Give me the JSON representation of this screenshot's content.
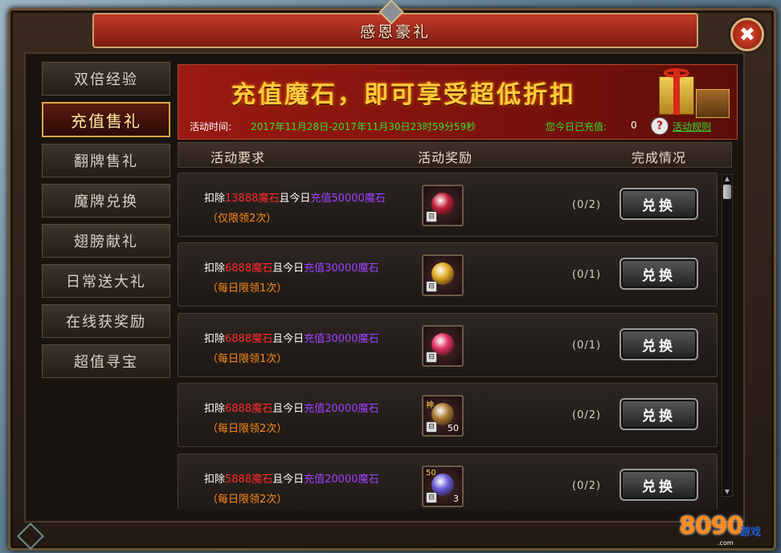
{
  "window": {
    "title": "感恩豪礼",
    "close_label": "✖"
  },
  "sidebar": {
    "items": [
      {
        "label": "双倍经验",
        "active": false
      },
      {
        "label": "充值售礼",
        "active": true
      },
      {
        "label": "翻牌售礼",
        "active": false
      },
      {
        "label": "魔牌兑换",
        "active": false
      },
      {
        "label": "翅膀献礼",
        "active": false
      },
      {
        "label": "日常送大礼",
        "active": false
      },
      {
        "label": "在线获奖励",
        "active": false
      },
      {
        "label": "超值寻宝",
        "active": false
      }
    ]
  },
  "banner": {
    "slogan": "充值魔石，即可享受超低折扣",
    "time_label": "活动时间:",
    "time_value": "2017年11月28日-2017年11月30日23时59分59秒",
    "charged_label": "您今日已充值:",
    "charged_value": "0",
    "help_label": "?",
    "rules_link": "活动规则"
  },
  "table": {
    "headers": {
      "requirement": "活动要求",
      "reward": "活动奖励",
      "status": "完成情况"
    },
    "rows": [
      {
        "prefix": "扣除",
        "cost": "13888魔石",
        "mid": "且今日",
        "charge": "充值50000魔石",
        "limit": "（仅限领2次）",
        "progress": "(0/2)",
        "button": "兑换",
        "reward_icon": "red-orb-icon",
        "reward_color": "#c0203a",
        "reward_count": "",
        "reward_tag": ""
      },
      {
        "prefix": "扣除",
        "cost": "6888魔石",
        "mid": "且今日",
        "charge": "充值30000魔石",
        "limit": "（每日限领1次）",
        "progress": "(0/1)",
        "button": "兑换",
        "reward_icon": "gold-crystal-icon",
        "reward_color": "#e0a820",
        "reward_count": "",
        "reward_tag": ""
      },
      {
        "prefix": "扣除",
        "cost": "6888魔石",
        "mid": "且今日",
        "charge": "充值30000魔石",
        "limit": "（每日限领1次）",
        "progress": "(0/1)",
        "button": "兑换",
        "reward_icon": "red-crystal-icon",
        "reward_color": "#e03060",
        "reward_count": "",
        "reward_tag": ""
      },
      {
        "prefix": "扣除",
        "cost": "6888魔石",
        "mid": "且今日",
        "charge": "充值20000魔石",
        "limit": "（每日限领2次）",
        "progress": "(0/2)",
        "button": "兑换",
        "reward_icon": "divine-scroll-icon",
        "reward_color": "#a87a30",
        "reward_count": "50",
        "reward_tag": "神"
      },
      {
        "prefix": "扣除",
        "cost": "5888魔石",
        "mid": "且今日",
        "charge": "充值20000魔石",
        "limit": "（每日限领2次）",
        "progress": "(0/2)",
        "button": "兑换",
        "reward_icon": "soul-orb-icon",
        "reward_color": "#6a5ad8",
        "reward_count": "3",
        "reward_tag": "50"
      }
    ]
  },
  "watermark": {
    "number": "8090",
    "game": "游戏",
    "domain": ".com"
  }
}
